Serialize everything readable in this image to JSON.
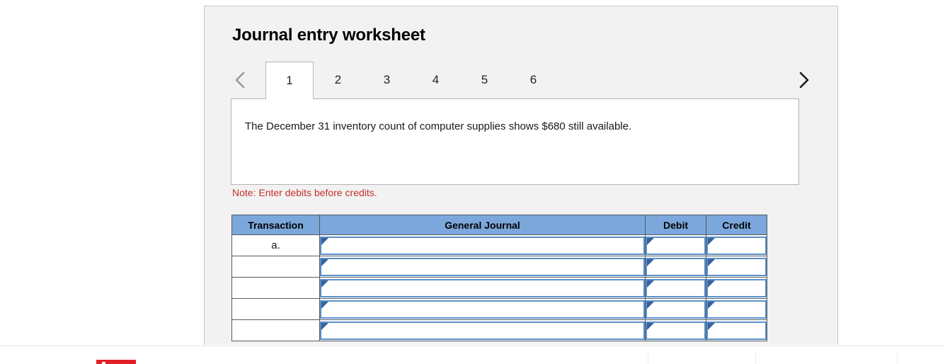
{
  "worksheet": {
    "title": "Journal entry worksheet",
    "nav": {
      "prev_icon": "chevron-left-icon",
      "next_icon": "chevron-right-icon"
    },
    "tabs": [
      {
        "label": "1",
        "active": true
      },
      {
        "label": "2",
        "active": false
      },
      {
        "label": "3",
        "active": false
      },
      {
        "label": "4",
        "active": false
      },
      {
        "label": "5",
        "active": false
      },
      {
        "label": "6",
        "active": false
      }
    ],
    "scenario_text": "The December 31 inventory count of computer supplies shows $680 still available.",
    "note": "Note: Enter debits before credits.",
    "note_color": "#c4302b",
    "header_color": "#7ba7dc",
    "input_border_color": "#5b8fc9",
    "marker_color": "#36629e",
    "table": {
      "columns": [
        "Transaction",
        "General Journal",
        "Debit",
        "Credit"
      ],
      "rows": [
        {
          "transaction": "a.",
          "general_journal": "",
          "debit": "",
          "credit": ""
        },
        {
          "transaction": "",
          "general_journal": "",
          "debit": "",
          "credit": ""
        },
        {
          "transaction": "",
          "general_journal": "",
          "debit": "",
          "credit": ""
        },
        {
          "transaction": "",
          "general_journal": "",
          "debit": "",
          "credit": ""
        },
        {
          "transaction": "",
          "general_journal": "",
          "debit": "",
          "credit": ""
        }
      ]
    }
  }
}
